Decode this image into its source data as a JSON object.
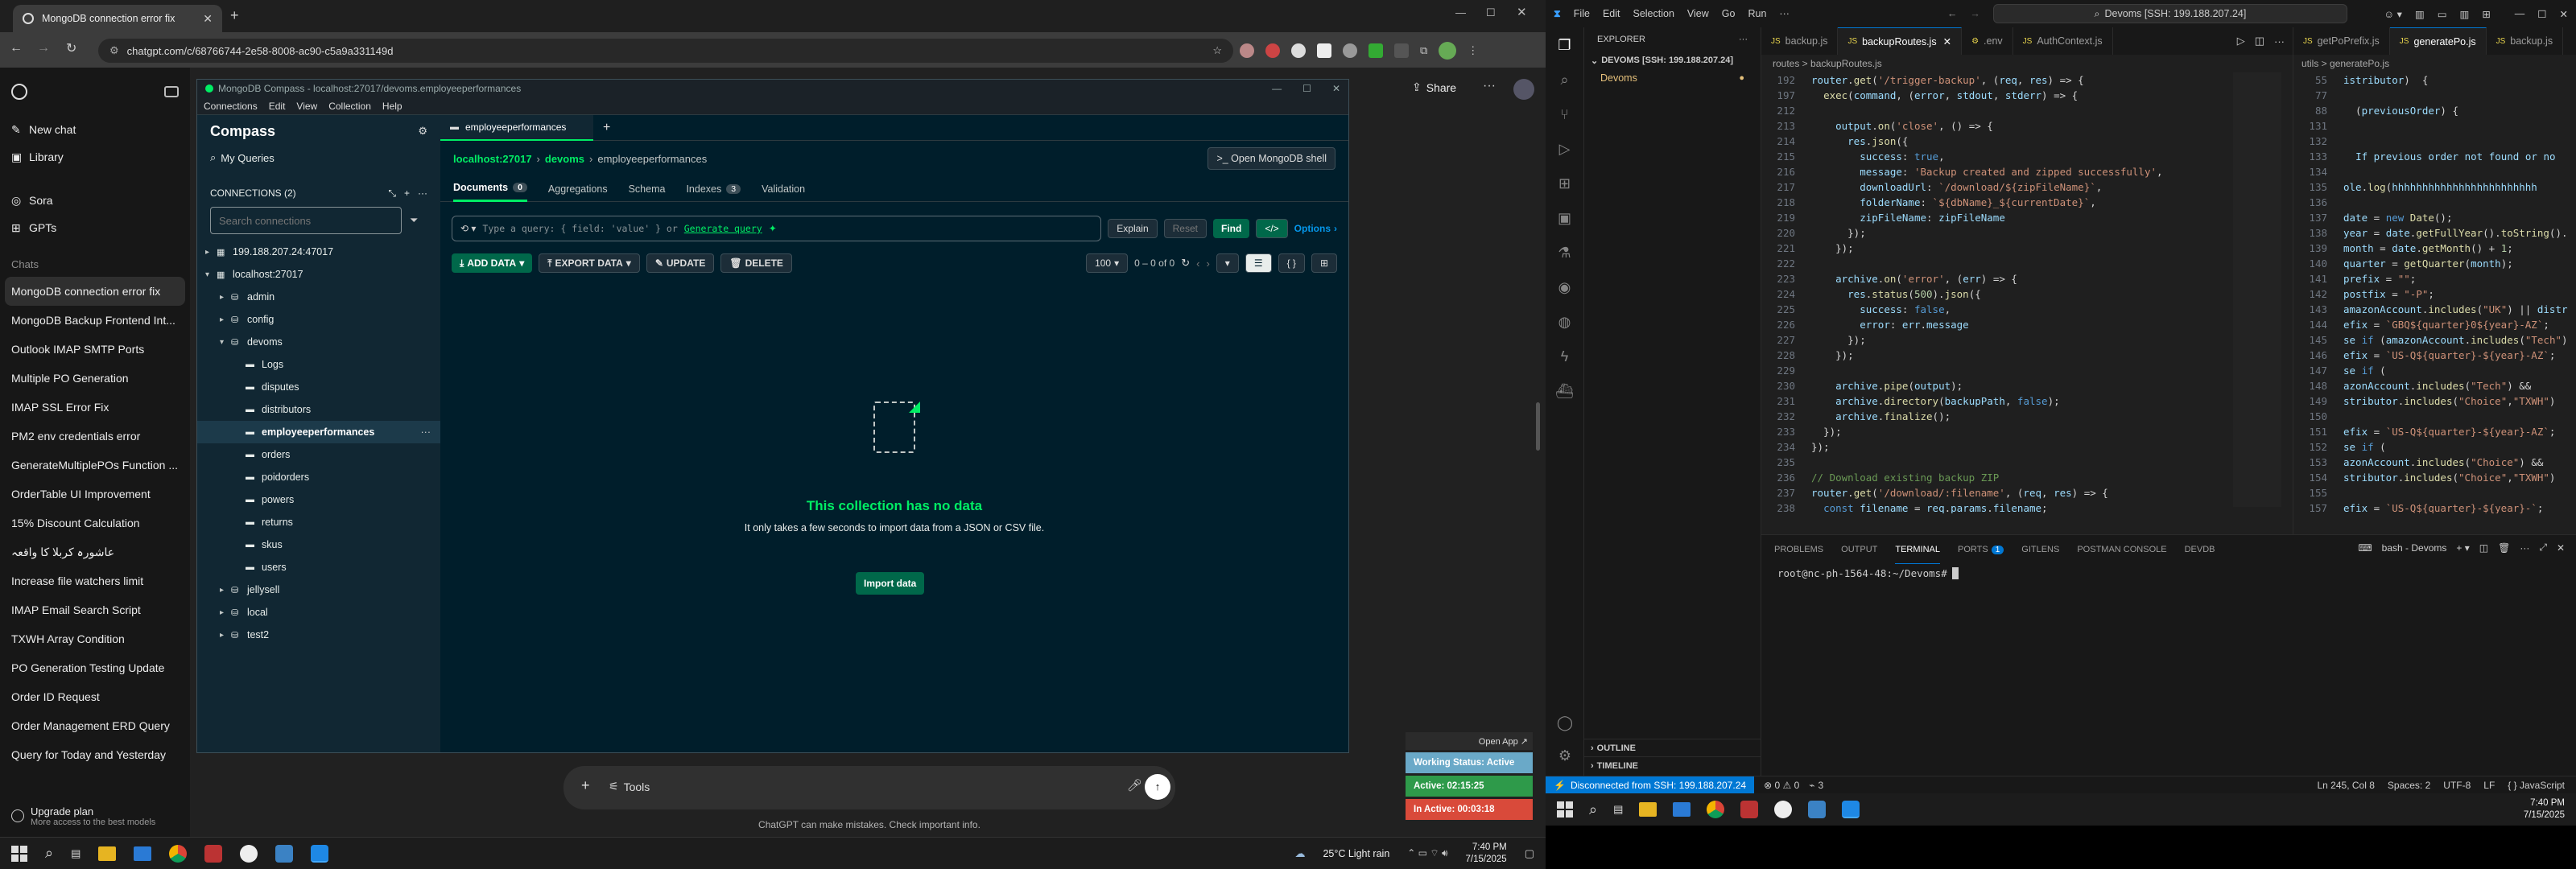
{
  "browser": {
    "tab_title": "MongoDB connection error fix",
    "url": "chatgpt.com/c/68766744-2e58-8008-ac90-c5a9a331149d"
  },
  "chatgpt": {
    "menu": [
      {
        "label": "New chat"
      },
      {
        "label": "Library"
      },
      {
        "label": "Sora"
      },
      {
        "label": "GPTs"
      }
    ],
    "chats_heading": "Chats",
    "chats": [
      "MongoDB connection error fix",
      "MongoDB Backup Frontend Int...",
      "Outlook IMAP SMTP Ports",
      "Multiple PO Generation",
      "IMAP SSL Error Fix",
      "PM2 env credentials error",
      "GenerateMultiplePOs Function ...",
      "OrderTable UI Improvement",
      "15% Discount Calculation",
      "عاشورہ کربلا کا واقعہ",
      "Increase file watchers limit",
      "IMAP Email Search Script",
      "TXWH Array Condition",
      "PO Generation Testing Update",
      "Order ID Request",
      "Order Management ERD Query",
      "Query for Today and Yesterday"
    ],
    "upgrade_title": "Upgrade plan",
    "upgrade_sub": "More access to the best models",
    "share": "Share",
    "tools": "Tools",
    "disclaimer": "ChatGPT can make mistakes. Check important info."
  },
  "compass": {
    "window_title": "MongoDB Compass - localhost:27017/devoms.employeeperformances",
    "menu": [
      "Connections",
      "Edit",
      "View",
      "Collection",
      "Help"
    ],
    "brand": "Compass",
    "my_queries": "My Queries",
    "connections_label": "CONNECTIONS (2)",
    "search_placeholder": "Search connections",
    "tree": [
      {
        "label": "199.188.207.24:47017",
        "depth": 0,
        "icon": "server-icon",
        "expanded": false
      },
      {
        "label": "localhost:27017",
        "depth": 0,
        "icon": "server-icon",
        "expanded": true
      },
      {
        "label": "admin",
        "depth": 1,
        "icon": "db-icon",
        "expanded": false
      },
      {
        "label": "config",
        "depth": 1,
        "icon": "db-icon",
        "expanded": false
      },
      {
        "label": "devoms",
        "depth": 1,
        "icon": "db-icon",
        "expanded": true
      },
      {
        "label": "Logs",
        "depth": 2,
        "icon": "folder-icon"
      },
      {
        "label": "disputes",
        "depth": 2,
        "icon": "folder-icon"
      },
      {
        "label": "distributors",
        "depth": 2,
        "icon": "folder-icon"
      },
      {
        "label": "employeeperformances",
        "depth": 2,
        "icon": "folder-icon",
        "selected": true
      },
      {
        "label": "orders",
        "depth": 2,
        "icon": "folder-icon"
      },
      {
        "label": "poidorders",
        "depth": 2,
        "icon": "folder-icon"
      },
      {
        "label": "powers",
        "depth": 2,
        "icon": "folder-icon"
      },
      {
        "label": "returns",
        "depth": 2,
        "icon": "folder-icon"
      },
      {
        "label": "skus",
        "depth": 2,
        "icon": "folder-icon"
      },
      {
        "label": "users",
        "depth": 2,
        "icon": "folder-icon"
      },
      {
        "label": "jellysell",
        "depth": 1,
        "icon": "db-icon",
        "expanded": false
      },
      {
        "label": "local",
        "depth": 1,
        "icon": "db-icon",
        "expanded": false
      },
      {
        "label": "test2",
        "depth": 1,
        "icon": "db-icon",
        "expanded": false
      }
    ],
    "tab_label": "employeeperformances",
    "breadcrumb": {
      "host": "localhost:27017",
      "db": "devoms",
      "coll": "employeeperformances"
    },
    "shell_button": ">_ Open MongoDB shell",
    "subtabs": [
      {
        "label": "Documents",
        "badge": "0"
      },
      {
        "label": "Aggregations",
        "badge": ""
      },
      {
        "label": "Schema",
        "badge": ""
      },
      {
        "label": "Indexes",
        "badge": "3"
      },
      {
        "label": "Validation",
        "badge": ""
      }
    ],
    "query_placeholder": "Type a query: { field: 'value' } or",
    "generate_query": "Generate query",
    "explain": "Explain",
    "reset": "Reset",
    "find": "Find",
    "options": "Options",
    "add_data": "ADD DATA",
    "export_data": "EXPORT DATA",
    "update": "UPDATE",
    "delete": "DELETE",
    "page_size": "100",
    "range": "0 – 0 of 0",
    "empty_title": "This collection has no data",
    "empty_sub": "It only takes a few seconds to import data from a JSON or CSV file.",
    "import_button": "Import data"
  },
  "widget": {
    "open_app": "Open App ↗",
    "working": "Working Status: Active",
    "active": "Active: 02:15:25",
    "inactive": "In Active: 00:03:18"
  },
  "taskbar_left": {
    "weather": "25°C  Light rain",
    "time": "7:40 PM",
    "date": "7/15/2025"
  },
  "vscode": {
    "menu": [
      "File",
      "Edit",
      "Selection",
      "View",
      "Go",
      "Run",
      "···"
    ],
    "search": "Devoms [SSH: 199.188.207.24]",
    "explorer_title": "EXPLORER",
    "folder": "DEVOMS [SSH: 199.188.207.24]",
    "root": "Devoms",
    "tabs": [
      {
        "label": "backup.js",
        "active": false
      },
      {
        "label": "backupRoutes.js",
        "active": true
      },
      {
        "label": ".env",
        "active": false
      },
      {
        "label": "AuthContext.js",
        "active": false
      }
    ],
    "breadcrumb": "routes > backupRoutes.js",
    "tabs2": [
      {
        "label": "getPoPrefix.js"
      },
      {
        "label": "generatePo.js"
      },
      {
        "label": "backup.js"
      }
    ],
    "breadcrumb2": "utils > generatePo.js",
    "code": [
      {
        "n": "192",
        "t": "router.get('/trigger-backup', (req, res) => {"
      },
      {
        "n": "197",
        "t": "  exec(command, (error, stdout, stderr) => {"
      },
      {
        "n": "212",
        "t": ""
      },
      {
        "n": "213",
        "t": "    output.on('close', () => {"
      },
      {
        "n": "214",
        "t": "      res.json({"
      },
      {
        "n": "215",
        "t": "        success: true,"
      },
      {
        "n": "216",
        "t": "        message: 'Backup created and zipped successfully',"
      },
      {
        "n": "217",
        "t": "        downloadUrl: `/download/${zipFileName}`,"
      },
      {
        "n": "218",
        "t": "        folderName: `${dbName}_${currentDate}`,"
      },
      {
        "n": "219",
        "t": "        zipFileName: zipFileName"
      },
      {
        "n": "220",
        "t": "      });"
      },
      {
        "n": "221",
        "t": "    });"
      },
      {
        "n": "222",
        "t": ""
      },
      {
        "n": "223",
        "t": "    archive.on('error', (err) => {"
      },
      {
        "n": "224",
        "t": "      res.status(500).json({"
      },
      {
        "n": "225",
        "t": "        success: false,"
      },
      {
        "n": "226",
        "t": "        error: err.message"
      },
      {
        "n": "227",
        "t": "      });"
      },
      {
        "n": "228",
        "t": "    });"
      },
      {
        "n": "229",
        "t": ""
      },
      {
        "n": "230",
        "t": "    archive.pipe(output);"
      },
      {
        "n": "231",
        "t": "    archive.directory(backupPath, false);"
      },
      {
        "n": "232",
        "t": "    archive.finalize();"
      },
      {
        "n": "233",
        "t": "  });"
      },
      {
        "n": "234",
        "t": "});"
      },
      {
        "n": "235",
        "t": ""
      },
      {
        "n": "236",
        "t": "// Download existing backup ZIP"
      },
      {
        "n": "237",
        "t": "router.get('/download/:filename', (req, res) => {"
      },
      {
        "n": "238",
        "t": "  const filename = req.params.filename;"
      }
    ],
    "code2": [
      {
        "n": "55",
        "t": "istributor)  {"
      },
      {
        "n": "77",
        "t": ""
      },
      {
        "n": "88",
        "t": "  (previousOrder) {"
      },
      {
        "n": "131",
        "t": ""
      },
      {
        "n": "132",
        "t": ""
      },
      {
        "n": "133",
        "t": "  If previous order not found or no"
      },
      {
        "n": "134",
        "t": ""
      },
      {
        "n": "135",
        "t": "ole.log(\"hhhhhhhhhhhhhhhhhhhhhhhh"
      },
      {
        "n": "136",
        "t": ""
      },
      {
        "n": "137",
        "t": "date = new Date();"
      },
      {
        "n": "138",
        "t": "year = date.getFullYear().toString()."
      },
      {
        "n": "139",
        "t": "month = date.getMonth() + 1;"
      },
      {
        "n": "140",
        "t": "quarter = getQuarter(month);"
      },
      {
        "n": "141",
        "t": "prefix = \"\";"
      },
      {
        "n": "142",
        "t": "postfix = \"-P\";"
      },
      {
        "n": "143",
        "t": "amazonAccount.includes(\"UK\") || distr"
      },
      {
        "n": "144",
        "t": "efix = `GBQ${quarter}0${year}-AZ`;"
      },
      {
        "n": "145",
        "t": "se if (amazonAccount.includes(\"Tech\")"
      },
      {
        "n": "146",
        "t": "efix = `US-Q${quarter}-${year}-AZ`;"
      },
      {
        "n": "147",
        "t": "se if ("
      },
      {
        "n": "148",
        "t": "azonAccount.includes(\"Tech\") &&"
      },
      {
        "n": "149",
        "t": "stributor.includes(\"Choice\",\"TXWH\")"
      },
      {
        "n": "150",
        "t": ""
      },
      {
        "n": "151",
        "t": "efix = `US-Q${quarter}-${year}-AZ`;"
      },
      {
        "n": "152",
        "t": "se if ("
      },
      {
        "n": "153",
        "t": "azonAccount.includes(\"Choice\") &&"
      },
      {
        "n": "154",
        "t": "stributor.includes(\"Choice\",\"TXWH\")"
      },
      {
        "n": "155",
        "t": ""
      },
      {
        "n": "157",
        "t": "efix = `US-Q${quarter}-${year}-`;"
      }
    ],
    "panel_tabs": [
      "PROBLEMS",
      "OUTPUT",
      "TERMINAL",
      "PORTS",
      "GITLENS",
      "POSTMAN CONSOLE",
      "DEVDB"
    ],
    "ports_badge": "1",
    "terminal_name": "bash - Devoms",
    "prompt": "root@nc-ph-1564-48:~/Devoms#",
    "outline": "OUTLINE",
    "timeline": "TIMELINE",
    "status_remote": "Disconnected from SSH: 199.188.207.24",
    "status_problems": "⊗ 0 ⚠ 0",
    "status_ports": "3",
    "status_right": [
      "Ln 245, Col 8",
      "Spaces: 2",
      "UTF-8",
      "LF",
      "{ } JavaScript"
    ]
  },
  "taskbar_right": {
    "time": "7:40 PM",
    "date": "7/15/2025"
  },
  "colors": {
    "mongo_green": "#00ed64",
    "vscode_blue": "#0078d4"
  }
}
